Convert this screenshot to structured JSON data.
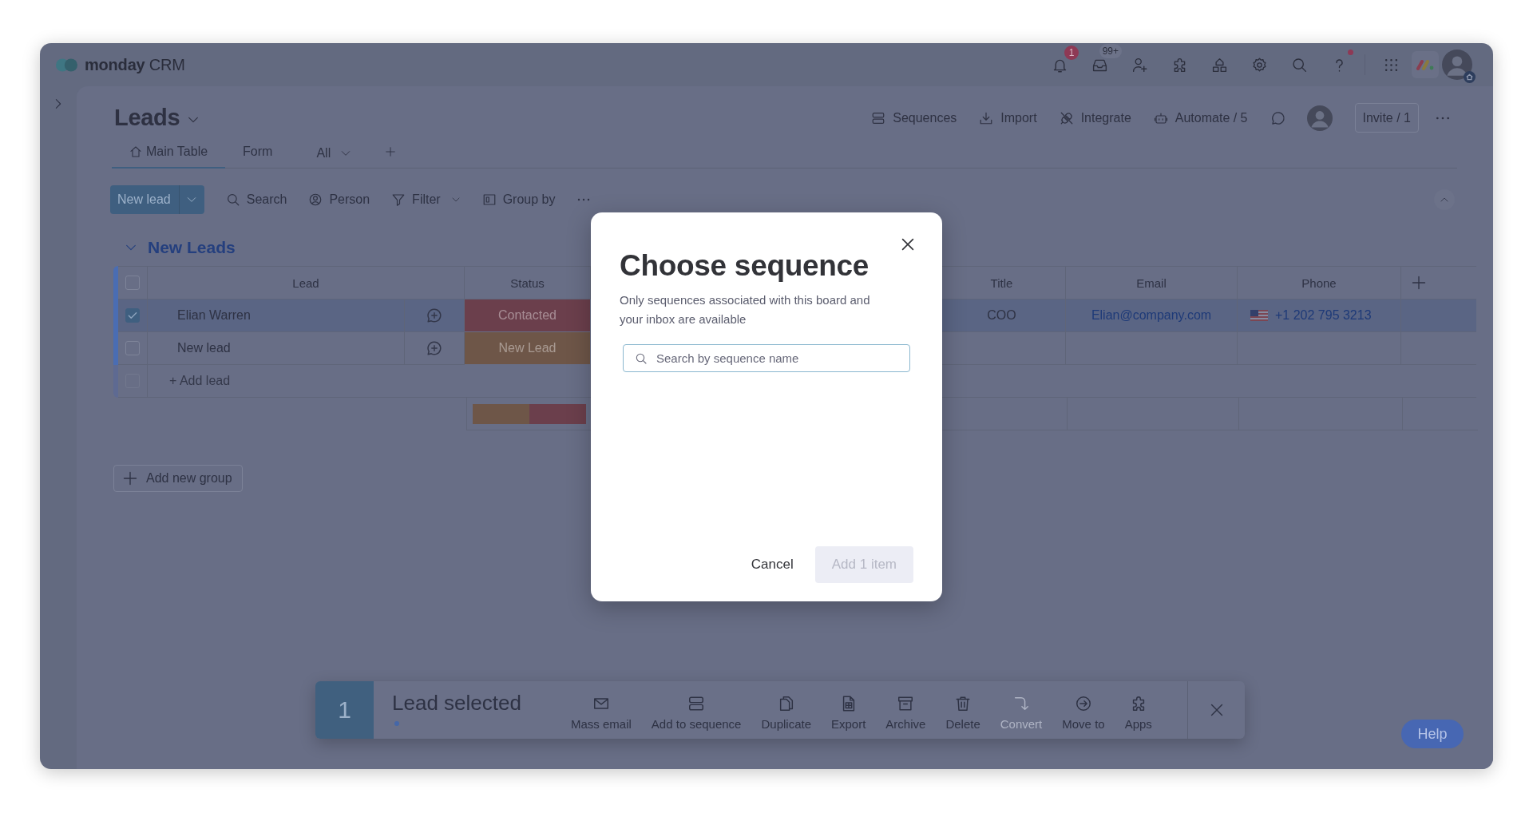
{
  "app": {
    "logo": "**monday** CRM"
  },
  "top_bar": {
    "icons": [
      {
        "kind": "bell",
        "badge": {
          "text": "1",
          "kind": "count"
        },
        "alert": false
      },
      {
        "kind": "inbox",
        "badge": {
          "text": "99+",
          "kind": "pill"
        },
        "alert": false
      },
      {
        "kind": "add_person",
        "alert": false
      },
      {
        "kind": "puzzle",
        "alert": false
      },
      {
        "kind": "shapes",
        "alert": false
      },
      {
        "kind": "settings",
        "alert": false
      },
      {
        "kind": "search",
        "alert": false
      },
      {
        "kind": "help",
        "alert": true
      }
    ]
  },
  "board": {
    "title": "Leads",
    "actions": [
      {
        "label": "Sequences",
        "kind": "sequences"
      },
      {
        "label": "Import",
        "kind": "import"
      },
      {
        "label": "Integrate",
        "kind": "integrate"
      },
      {
        "label": "Automate / 5",
        "kind": "automate"
      }
    ],
    "invite": "Invite / 1",
    "views": [
      {
        "label": "Main Table",
        "kind": "home",
        "selected": true
      },
      {
        "label": "Form",
        "kind": "plain",
        "selected": false
      }
    ],
    "view_selector": "All"
  },
  "toolbar": {
    "new_button": "New lead",
    "items": [
      {
        "label": "Search",
        "kind": "search"
      },
      {
        "label": "Person",
        "kind": "person"
      },
      {
        "label": "Filter",
        "kind": "filter"
      },
      {
        "label": "Group by",
        "kind": "group"
      }
    ]
  },
  "group": {
    "title": "New Leads",
    "expanded": true
  },
  "table": {
    "select_all": false,
    "columns": [
      {
        "label": "Lead"
      },
      {
        "label": "Status"
      },
      {
        "label": "Title"
      },
      {
        "label": "Email"
      },
      {
        "label": "Phone"
      }
    ],
    "rows": [
      {
        "selected": true,
        "lead": "Elian Warren",
        "status": {
          "label": "Contacted",
          "color": "#6b3f4c"
        },
        "title": "COO",
        "email": "Elian@company.com",
        "phone": "+1 202 795 3213"
      },
      {
        "selected": false,
        "lead": "New lead",
        "status": {
          "label": "New Lead",
          "color": "#6e5648"
        }
      }
    ],
    "add_row": {
      "placeholder": "+ Add lead",
      "checked": false
    }
  },
  "add_group": "Add new group",
  "modal": {
    "title": "Choose sequence",
    "description": "Only sequences associated with this board and your inbox are available",
    "search": {
      "placeholder": "Search by sequence name"
    },
    "buttons": [
      {
        "label": "Cancel",
        "kind": "secondary",
        "disabled": false
      },
      {
        "label": "Add 1 item",
        "kind": "primary",
        "disabled": true
      }
    ]
  },
  "bulk_bar": {
    "count": "1",
    "label": "Lead selected",
    "actions": [
      {
        "label": "Mass email",
        "kind": "mail",
        "disabled": false
      },
      {
        "label": "Add to sequence",
        "kind": "sequence",
        "disabled": false
      },
      {
        "label": "Duplicate",
        "kind": "duplicate",
        "disabled": false
      },
      {
        "label": "Export",
        "kind": "export",
        "disabled": false
      },
      {
        "label": "Archive",
        "kind": "archive",
        "disabled": false
      },
      {
        "label": "Delete",
        "kind": "delete",
        "disabled": false
      },
      {
        "label": "Convert",
        "kind": "convert",
        "disabled": true
      },
      {
        "label": "Move to",
        "kind": "move",
        "disabled": false
      },
      {
        "label": "Apps",
        "kind": "apps",
        "disabled": false
      }
    ]
  },
  "help_button": "Help"
}
